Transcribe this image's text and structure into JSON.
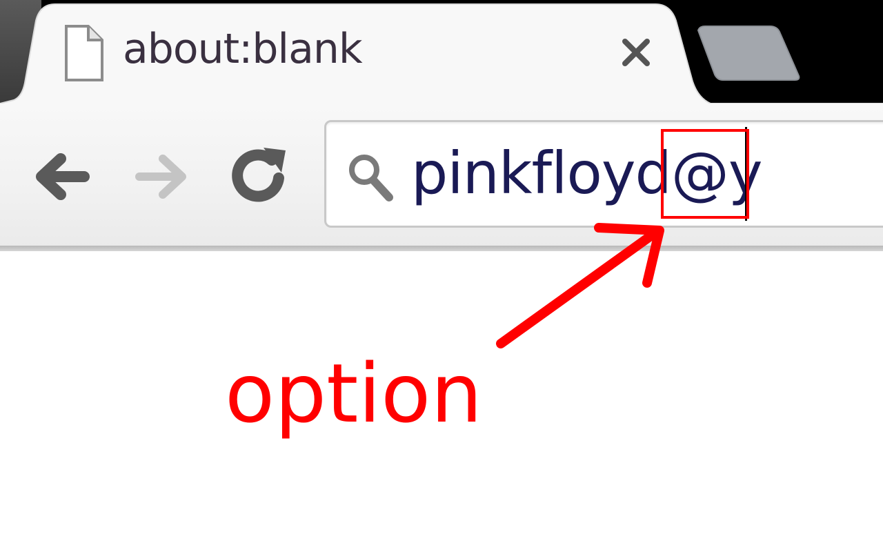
{
  "browser": {
    "tab": {
      "title": "about:blank",
      "favicon": "blank-page-icon",
      "close_icon": "close-icon"
    },
    "new_tab_icon": "new-tab-icon",
    "toolbar": {
      "back_icon": "back-arrow-icon",
      "forward_icon": "forward-arrow-icon",
      "reload_icon": "reload-icon",
      "forward_enabled": false
    },
    "omnibox": {
      "icon": "search-icon",
      "value": "pinkfloyd@y"
    }
  },
  "annotation": {
    "label": "option",
    "color": "#ff0000",
    "highlighted_text": "@y"
  }
}
